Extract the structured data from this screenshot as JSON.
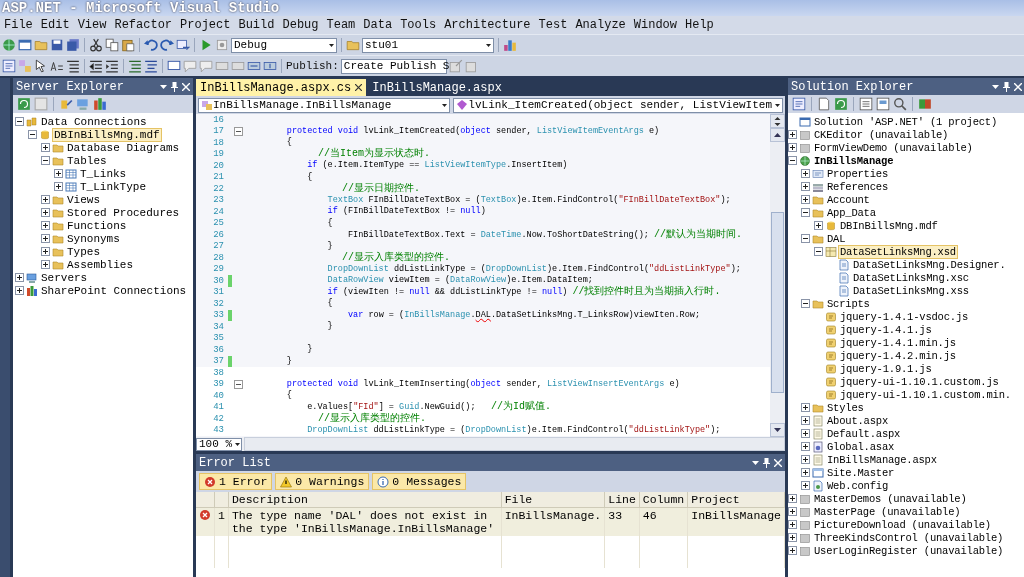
{
  "window": {
    "title": "ASP.NET - Microsoft Visual Studio"
  },
  "menu": [
    "File",
    "Edit",
    "View",
    "Refactor",
    "Project",
    "Build",
    "Debug",
    "Team",
    "Data",
    "Tools",
    "Architecture",
    "Test",
    "Analyze",
    "Window",
    "Help"
  ],
  "toolbar": {
    "configuration": "Debug",
    "platform": "stu01",
    "publish_label": "Publish:",
    "publish_profile": "Create Publish S"
  },
  "server_explorer": {
    "title": "Server Explorer",
    "tree": [
      {
        "label": "Data Connections",
        "kind": "connections",
        "expanded": true,
        "selected": false,
        "children": [
          {
            "label": "DBInBillsMng.mdf",
            "kind": "database",
            "expanded": true,
            "selected": true,
            "children": [
              {
                "label": "Database Diagrams",
                "kind": "folder",
                "expanded": false,
                "selected": false
              },
              {
                "label": "Tables",
                "kind": "folder",
                "expanded": true,
                "selected": false,
                "children": [
                  {
                    "label": "T_Links",
                    "kind": "table",
                    "expanded": false,
                    "selected": false
                  },
                  {
                    "label": "T_LinkType",
                    "kind": "table",
                    "expanded": false,
                    "selected": false
                  }
                ]
              },
              {
                "label": "Views",
                "kind": "folder",
                "expanded": false,
                "selected": false
              },
              {
                "label": "Stored Procedures",
                "kind": "folder",
                "expanded": false,
                "selected": false
              },
              {
                "label": "Functions",
                "kind": "folder",
                "expanded": false,
                "selected": false
              },
              {
                "label": "Synonyms",
                "kind": "folder",
                "expanded": false,
                "selected": false
              },
              {
                "label": "Types",
                "kind": "folder",
                "expanded": false,
                "selected": false
              },
              {
                "label": "Assemblies",
                "kind": "folder",
                "expanded": false,
                "selected": false
              }
            ]
          }
        ]
      },
      {
        "label": "Servers",
        "kind": "server",
        "expanded": false,
        "selected": false
      },
      {
        "label": "SharePoint Connections",
        "kind": "sharepoint",
        "expanded": false,
        "selected": false
      }
    ]
  },
  "editor": {
    "tabs": [
      {
        "label": "InBillsManage.aspx.cs",
        "selected": true
      },
      {
        "label": "InBillsManage.aspx",
        "selected": false
      }
    ],
    "type_dropdown": "InBillsManage.InBillsManage",
    "member_dropdown": "lvLink_ItemCreated(object sender, ListViewItem",
    "zoom": "100 %",
    "lines": [
      {
        "number": "16",
        "changed": false,
        "fold": false
      },
      {
        "number": "17",
        "changed": false,
        "fold": true,
        "tokens": [
          {
            "kind": "keyword",
            "text": "        protected"
          },
          {
            "kind": "keyword",
            "text": " void"
          },
          {
            "kind": "plain",
            "text": " lvLink_ItemCreated("
          },
          {
            "kind": "keyword",
            "text": "object"
          },
          {
            "kind": "plain",
            "text": " sender, "
          },
          {
            "kind": "type",
            "text": "ListViewItemEventArgs"
          },
          {
            "kind": "plain",
            "text": " e)"
          }
        ]
      },
      {
        "number": "18",
        "changed": false,
        "fold": false,
        "tokens": [
          {
            "kind": "plain",
            "text": "        {"
          }
        ]
      },
      {
        "number": "19",
        "changed": false,
        "fold": false,
        "tokens": [
          {
            "kind": "comment",
            "text": "            //当Item为显示状态时."
          }
        ]
      },
      {
        "number": "20",
        "changed": false,
        "fold": false,
        "tokens": [
          {
            "kind": "keyword",
            "text": "            if"
          },
          {
            "kind": "plain",
            "text": " (e.Item.ItemType == "
          },
          {
            "kind": "type",
            "text": "ListViewItemType"
          },
          {
            "kind": "plain",
            "text": ".InsertItem)"
          }
        ]
      },
      {
        "number": "21",
        "changed": false,
        "fold": false,
        "tokens": [
          {
            "kind": "plain",
            "text": "            {"
          }
        ]
      },
      {
        "number": "22",
        "changed": false,
        "fold": false,
        "tokens": [
          {
            "kind": "comment",
            "text": "                //显示日期控件."
          }
        ]
      },
      {
        "number": "23",
        "changed": false,
        "fold": false,
        "tokens": [
          {
            "kind": "type",
            "text": "                TextBox"
          },
          {
            "kind": "plain",
            "text": " FInBillDateTextBox = ("
          },
          {
            "kind": "type",
            "text": "TextBox"
          },
          {
            "kind": "plain",
            "text": ")e.Item.FindControl("
          },
          {
            "kind": "string",
            "text": "\"FInBillDateTextBox\""
          },
          {
            "kind": "plain",
            "text": ");"
          }
        ]
      },
      {
        "number": "24",
        "changed": false,
        "fold": false,
        "tokens": [
          {
            "kind": "keyword",
            "text": "                if"
          },
          {
            "kind": "plain",
            "text": " (FInBillDateTextBox != "
          },
          {
            "kind": "keyword",
            "text": "null"
          },
          {
            "kind": "plain",
            "text": ")"
          }
        ]
      },
      {
        "number": "25",
        "changed": false,
        "fold": false,
        "tokens": [
          {
            "kind": "plain",
            "text": "                {"
          }
        ]
      },
      {
        "number": "26",
        "changed": false,
        "fold": false,
        "tokens": [
          {
            "kind": "plain",
            "text": "                    FInBillDateTextBox.Text = "
          },
          {
            "kind": "type",
            "text": "DateTime"
          },
          {
            "kind": "plain",
            "text": ".Now.ToShortDateString(); "
          },
          {
            "kind": "comment",
            "text": "//默认为当期时间."
          }
        ]
      },
      {
        "number": "27",
        "changed": false,
        "fold": false,
        "tokens": [
          {
            "kind": "plain",
            "text": "                }"
          }
        ]
      },
      {
        "number": "28",
        "changed": false,
        "fold": false,
        "tokens": [
          {
            "kind": "comment",
            "text": "                //显示入库类型的控件."
          }
        ]
      },
      {
        "number": "29",
        "changed": false,
        "fold": false,
        "tokens": [
          {
            "kind": "type",
            "text": "                DropDownList"
          },
          {
            "kind": "plain",
            "text": " ddListLinkType = ("
          },
          {
            "kind": "type",
            "text": "DropDownList"
          },
          {
            "kind": "plain",
            "text": ")e.Item.FindControl("
          },
          {
            "kind": "string",
            "text": "\"ddListLinkType\""
          },
          {
            "kind": "plain",
            "text": ");"
          }
        ]
      },
      {
        "number": "30",
        "changed": true,
        "fold": false,
        "tokens": [
          {
            "kind": "type",
            "text": "                DataRowView"
          },
          {
            "kind": "plain",
            "text": " viewItem = ("
          },
          {
            "kind": "type",
            "text": "DataRowView"
          },
          {
            "kind": "plain",
            "text": ")e.Item.DataItem;"
          }
        ]
      },
      {
        "number": "31",
        "changed": false,
        "fold": false,
        "tokens": [
          {
            "kind": "keyword",
            "text": "                if"
          },
          {
            "kind": "plain",
            "text": " (viewIten != "
          },
          {
            "kind": "keyword",
            "text": "null"
          },
          {
            "kind": "plain",
            "text": " && ddListLinkType != "
          },
          {
            "kind": "keyword",
            "text": "null"
          },
          {
            "kind": "plain",
            "text": ") "
          },
          {
            "kind": "comment",
            "text": "//找到控件时且为当期插入行时."
          }
        ]
      },
      {
        "number": "32",
        "changed": false,
        "fold": false,
        "tokens": [
          {
            "kind": "plain",
            "text": "                {"
          }
        ]
      },
      {
        "number": "33",
        "changed": true,
        "fold": false,
        "tokens": [
          {
            "kind": "keyword",
            "text": "                    var"
          },
          {
            "kind": "plain",
            "text": " row = ("
          },
          {
            "kind": "type",
            "text": "InBillsManage"
          },
          {
            "kind": "plain",
            "text": "."
          },
          {
            "kind": "error",
            "text": "DAL"
          },
          {
            "kind": "plain",
            "text": ".DataSetLinksMng.T_LinksRow)viewIten.Row;"
          }
        ]
      },
      {
        "number": "34",
        "changed": false,
        "fold": false,
        "tokens": [
          {
            "kind": "plain",
            "text": "                }"
          }
        ]
      },
      {
        "number": "35",
        "changed": false,
        "fold": false
      },
      {
        "number": "36",
        "changed": false,
        "fold": false,
        "tokens": [
          {
            "kind": "plain",
            "text": "            }"
          }
        ]
      },
      {
        "number": "37",
        "changed": true,
        "fold": false,
        "tokens": [
          {
            "kind": "plain",
            "text": "        }"
          }
        ]
      },
      {
        "number": "38",
        "changed": false,
        "fold": false
      },
      {
        "number": "39",
        "changed": false,
        "fold": true,
        "tokens": [
          {
            "kind": "keyword",
            "text": "        protected"
          },
          {
            "kind": "keyword",
            "text": " void"
          },
          {
            "kind": "plain",
            "text": " lvLink_ItemInserting("
          },
          {
            "kind": "keyword",
            "text": "object"
          },
          {
            "kind": "plain",
            "text": " sender, "
          },
          {
            "kind": "type",
            "text": "ListViewInsertEventArgs"
          },
          {
            "kind": "plain",
            "text": " e)"
          }
        ]
      },
      {
        "number": "40",
        "changed": false,
        "fold": false,
        "tokens": [
          {
            "kind": "plain",
            "text": "        {"
          }
        ]
      },
      {
        "number": "41",
        "changed": false,
        "fold": false,
        "tokens": [
          {
            "kind": "plain",
            "text": "            e.Values["
          },
          {
            "kind": "string",
            "text": "\"FId\""
          },
          {
            "kind": "plain",
            "text": "] = "
          },
          {
            "kind": "type",
            "text": "Guid"
          },
          {
            "kind": "plain",
            "text": ".NewGuid();   "
          },
          {
            "kind": "comment",
            "text": "//为Id赋值."
          }
        ]
      },
      {
        "number": "42",
        "changed": false,
        "fold": false,
        "tokens": [
          {
            "kind": "comment",
            "text": "            //显示入库类型的控件."
          }
        ]
      },
      {
        "number": "43",
        "changed": false,
        "fold": false,
        "tokens": [
          {
            "kind": "type",
            "text": "            DropDownList"
          },
          {
            "kind": "plain",
            "text": " ddListLinkType = ("
          },
          {
            "kind": "type",
            "text": "DropDownList"
          },
          {
            "kind": "plain",
            "text": ")e.Item.FindControl("
          },
          {
            "kind": "string",
            "text": "\"ddListLinkType\""
          },
          {
            "kind": "plain",
            "text": ");"
          }
        ]
      }
    ]
  },
  "error_list": {
    "title": "Error List",
    "filters": [
      {
        "label": "1 Error",
        "kind": "error",
        "selected": true
      },
      {
        "label": "0 Warnings",
        "kind": "warning",
        "selected": true
      },
      {
        "label": "0 Messages",
        "kind": "message",
        "selected": true
      }
    ],
    "columns": [
      "Description",
      "File",
      "Line",
      "Column",
      "Project"
    ],
    "rows": [
      {
        "kind": "error",
        "number": "1",
        "description": "The type name 'DAL' does not exist in the type 'InBillsManage.InBillsManage'",
        "file": "InBillsManage.",
        "line": "33",
        "column": "46",
        "project": "InBillsManage"
      }
    ]
  },
  "solution_explorer": {
    "title": "Solution Explorer",
    "tree": [
      {
        "label": "Solution 'ASP.NET' (1 project)",
        "kind": "solution",
        "selected": false,
        "bold": false
      },
      {
        "label": "CKEditor (unavailable)",
        "kind": "unavailable",
        "expanded": false,
        "selected": false,
        "bold": false
      },
      {
        "label": "FormViewDemo (unavailable)",
        "kind": "unavailable",
        "expanded": false,
        "selected": false,
        "bold": false
      },
      {
        "label": "InBillsManage",
        "kind": "project",
        "expanded": true,
        "selected": false,
        "bold": true,
        "children": [
          {
            "label": "Properties",
            "kind": "properties",
            "expanded": false,
            "selected": false,
            "bold": false
          },
          {
            "label": "References",
            "kind": "references",
            "expanded": false,
            "selected": false,
            "bold": false
          },
          {
            "label": "Account",
            "kind": "folder",
            "expanded": false,
            "selected": false,
            "bold": false
          },
          {
            "label": "App_Data",
            "kind": "folder",
            "expanded": true,
            "selected": false,
            "bold": false,
            "children": [
              {
                "label": "DBInBillsMng.mdf",
                "kind": "database",
                "expanded": false,
                "selected": false,
                "bold": false
              }
            ]
          },
          {
            "label": "DAL",
            "kind": "folder",
            "expanded": true,
            "selected": false,
            "bold": false,
            "children": [
              {
                "label": "DataSetLinksMng.xsd",
                "kind": "dataset",
                "expanded": true,
                "selected": true,
                "bold": false,
                "children": [
                  {
                    "label": "DataSetLinksMng.Designer.",
                    "kind": "file",
                    "selected": false,
                    "bold": false
                  },
                  {
                    "label": "DataSetLinksMng.xsc",
                    "kind": "file",
                    "selected": false,
                    "bold": false
                  },
                  {
                    "label": "DataSetLinksMng.xss",
                    "kind": "file",
                    "selected": false,
                    "bold": false
                  }
                ]
              }
            ]
          },
          {
            "label": "Scripts",
            "kind": "folder",
            "expanded": true,
            "selected": false,
            "bold": false,
            "children": [
              {
                "label": "jquery-1.4.1-vsdoc.js",
                "kind": "script",
                "selected": false,
                "bold": false
              },
              {
                "label": "jquery-1.4.1.js",
                "kind": "script",
                "selected": false,
                "bold": false
              },
              {
                "label": "jquery-1.4.1.min.js",
                "kind": "script",
                "selected": false,
                "bold": false
              },
              {
                "label": "jquery-1.4.2.min.js",
                "kind": "script",
                "selected": false,
                "bold": false
              },
              {
                "label": "jquery-1.9.1.js",
                "kind": "script",
                "selected": false,
                "bold": false
              },
              {
                "label": "jquery-ui-1.10.1.custom.js",
                "kind": "script",
                "selected": false,
                "bold": false
              },
              {
                "label": "jquery-ui-1.10.1.custom.min.",
                "kind": "script",
                "selected": false,
                "bold": false
              }
            ]
          },
          {
            "label": "Styles",
            "kind": "folder",
            "expanded": false,
            "selected": false,
            "bold": false
          },
          {
            "label": "About.aspx",
            "kind": "page",
            "expanded": false,
            "selected": false,
            "bold": false
          },
          {
            "label": "Default.aspx",
            "kind": "page",
            "expanded": false,
            "selected": false,
            "bold": false
          },
          {
            "label": "Global.asax",
            "kind": "asax",
            "expanded": false,
            "selected": false,
            "bold": false
          },
          {
            "label": "InBillsManage.aspx",
            "kind": "page",
            "expanded": false,
            "selected": false,
            "bold": false
          },
          {
            "label": "Site.Master",
            "kind": "master",
            "expanded": false,
            "selected": false,
            "bold": false
          },
          {
            "label": "Web.config",
            "kind": "config",
            "expanded": false,
            "selected": false,
            "bold": false
          }
        ]
      },
      {
        "label": "MasterDemos (unavailable)",
        "kind": "unavailable",
        "expanded": false,
        "selected": false,
        "bold": false
      },
      {
        "label": "MasterPage (unavailable)",
        "kind": "unavailable",
        "expanded": false,
        "selected": false,
        "bold": false
      },
      {
        "label": "PictureDownload (unavailable)",
        "kind": "unavailable",
        "expanded": false,
        "selected": false,
        "bold": false
      },
      {
        "label": "ThreeKindsControl (unavailable)",
        "kind": "unavailable",
        "expanded": false,
        "selected": false,
        "bold": false
      },
      {
        "label": "UserLoginRegister (unavailable)",
        "kind": "unavailable",
        "expanded": false,
        "selected": false,
        "bold": false
      }
    ]
  }
}
